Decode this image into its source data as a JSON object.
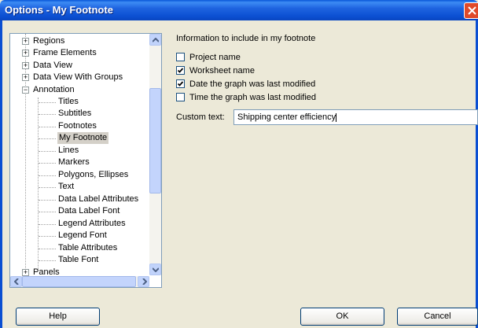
{
  "window": {
    "title": "Options - My Footnote"
  },
  "tree": {
    "items": [
      {
        "label": "Regions",
        "level": 0,
        "expander": "+"
      },
      {
        "label": "Frame Elements",
        "level": 0,
        "expander": "+"
      },
      {
        "label": "Data View",
        "level": 0,
        "expander": "+"
      },
      {
        "label": "Data View With Groups",
        "level": 0,
        "expander": "+"
      },
      {
        "label": "Annotation",
        "level": 0,
        "expander": "−"
      },
      {
        "label": "Titles",
        "level": 1
      },
      {
        "label": "Subtitles",
        "level": 1
      },
      {
        "label": "Footnotes",
        "level": 1
      },
      {
        "label": "My Footnote",
        "level": 1,
        "selected": true
      },
      {
        "label": "Lines",
        "level": 1
      },
      {
        "label": "Markers",
        "level": 1
      },
      {
        "label": "Polygons, Ellipses",
        "level": 1
      },
      {
        "label": "Text",
        "level": 1
      },
      {
        "label": "Data Label Attributes",
        "level": 1
      },
      {
        "label": "Data Label Font",
        "level": 1
      },
      {
        "label": "Legend Attributes",
        "level": 1
      },
      {
        "label": "Legend Font",
        "level": 1
      },
      {
        "label": "Table Attributes",
        "level": 1
      },
      {
        "label": "Table Font",
        "level": 1
      },
      {
        "label": "Panels",
        "level": 0,
        "expander": "+"
      }
    ]
  },
  "options": {
    "section_label": "Information to include in my footnote",
    "checkboxes": [
      {
        "label": "Project name",
        "checked": false
      },
      {
        "label": "Worksheet name",
        "checked": true
      },
      {
        "label": "Date the graph was last modified",
        "checked": true
      },
      {
        "label": "Time the graph was last modified",
        "checked": false
      }
    ],
    "custom_text_label": "Custom text:",
    "custom_text_value": "Shipping center efficiency"
  },
  "buttons": {
    "help": "Help",
    "ok": "OK",
    "cancel": "Cancel"
  },
  "colors": {
    "titlebar": "#0a58d8",
    "dialog_bg": "#ece9d8",
    "selection": "#d4d0c8"
  }
}
